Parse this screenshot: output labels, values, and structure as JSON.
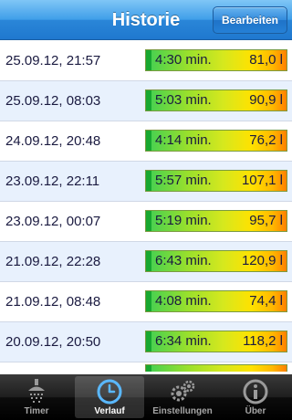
{
  "header": {
    "title": "Historie",
    "edit_label": "Bearbeiten"
  },
  "history": [
    {
      "date": "25.09.12, 21:57",
      "duration": "4:30 min.",
      "volume": "81,0 l"
    },
    {
      "date": "25.09.12, 08:03",
      "duration": "5:03 min.",
      "volume": "90,9 l"
    },
    {
      "date": "24.09.12, 20:48",
      "duration": "4:14 min.",
      "volume": "76,2 l"
    },
    {
      "date": "23.09.12, 22:11",
      "duration": "5:57 min.",
      "volume": "107,1 l"
    },
    {
      "date": "23.09.12, 00:07",
      "duration": "5:19 min.",
      "volume": "95,7 l"
    },
    {
      "date": "21.09.12, 22:28",
      "duration": "6:43 min.",
      "volume": "120,9 l"
    },
    {
      "date": "21.09.12, 08:48",
      "duration": "4:08 min.",
      "volume": "74,4 l"
    },
    {
      "date": "20.09.12, 20:50",
      "duration": "6:34 min.",
      "volume": "118,2 l"
    }
  ],
  "tabs": [
    {
      "label": "Timer",
      "icon": "shower-icon",
      "selected": false
    },
    {
      "label": "Verlauf",
      "icon": "clock-icon",
      "selected": true
    },
    {
      "label": "Einstellungen",
      "icon": "gears-icon",
      "selected": false
    },
    {
      "label": "Über",
      "icon": "info-icon",
      "selected": false
    }
  ],
  "colors": {
    "navbar": "#3f9ee9",
    "row_alt": "#e8f1fd",
    "bar_start": "#3ecb4a",
    "bar_end": "#ff8000",
    "tabbar": "#1e1e1e"
  }
}
